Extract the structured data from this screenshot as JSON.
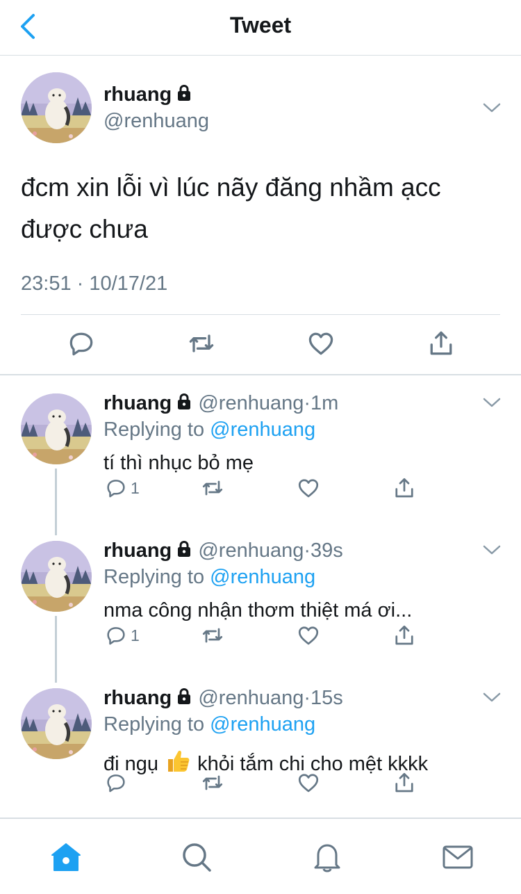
{
  "header": {
    "title": "Tweet"
  },
  "tweet": {
    "name": "rhuang",
    "handle": "@renhuang",
    "text": "đcm xin lỗi vì lúc nãy đăng nhầm ạcc được chưa",
    "timestamp": "23:51 · 10/17/21"
  },
  "replies": [
    {
      "name": "rhuang",
      "handle": "@renhuang",
      "sep": "·",
      "time": "1m",
      "replying_label": "Replying to",
      "replying_to": "@renhuang",
      "text": "tí thì nhục bỏ mẹ",
      "text_after_emoji": "",
      "reply_count": "1"
    },
    {
      "name": "rhuang",
      "handle": "@renhuang",
      "sep": "·",
      "time": "39s",
      "replying_label": "Replying to",
      "replying_to": "@renhuang",
      "text": "nma công nhận thơm thiệt má ơi...",
      "text_after_emoji": "",
      "reply_count": "1"
    },
    {
      "name": "rhuang",
      "handle": "@renhuang",
      "sep": "·",
      "time": "15s",
      "replying_label": "Replying to",
      "replying_to": "@renhuang",
      "text": "đi ngụ",
      "text_after_emoji": "khỏi tắm chi cho mệt kkkk",
      "reply_count": ""
    }
  ],
  "icons": [
    "back-chevron-icon",
    "lock-icon",
    "chevron-down-icon",
    "reply-icon",
    "retweet-icon",
    "like-icon",
    "share-icon",
    "thumbs-up-emoji",
    "home-icon",
    "search-icon",
    "notifications-icon",
    "messages-icon"
  ],
  "colors": {
    "accent": "#1da1f2",
    "secondary_text": "#657786",
    "text": "#14171a",
    "divider": "#d8dee3"
  }
}
